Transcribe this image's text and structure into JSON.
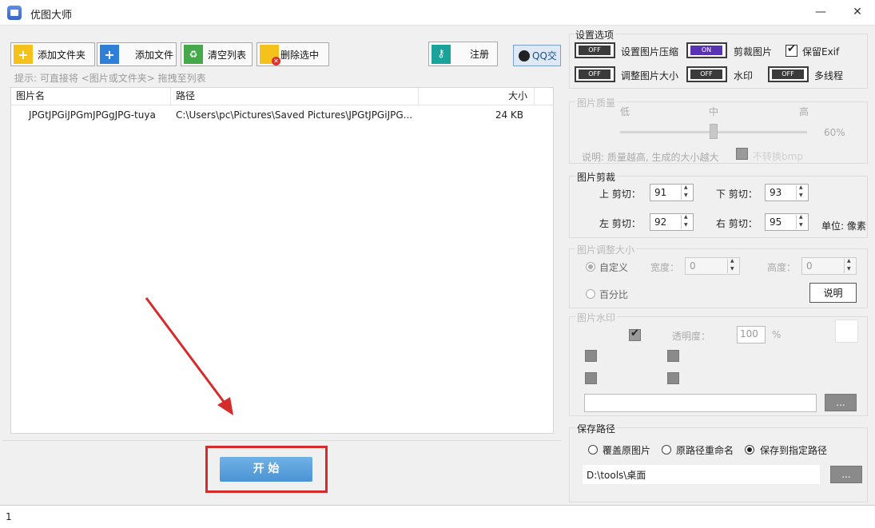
{
  "window": {
    "title": "优图大师",
    "minimize": "—",
    "close": "✕"
  },
  "toolbar": {
    "add_folder": "添加文件夹",
    "add_file": "添加文件",
    "clear_list": "清空列表",
    "delete_selected": "删除选中",
    "register": "注册",
    "qq": "QQ交"
  },
  "hint": "提示: 可直接将 <图片或文件夹> 拖拽至列表",
  "table": {
    "columns": [
      "图片名",
      "路径",
      "大小"
    ],
    "rows": [
      {
        "name": "JPGtJPGiJPGmJPGgJPG-tuya",
        "path": "C:\\Users\\pc\\Pictures\\Saved Pictures\\JPGtJPGiJPG...",
        "size": "24 KB"
      }
    ]
  },
  "start_button": "开 始",
  "settings": {
    "title": "设置选项",
    "off": "OFF",
    "on": "ON",
    "compress": "设置图片压缩",
    "crop": "剪裁图片",
    "keep_exif": "保留Exif",
    "resize": "调整图片大小",
    "watermark": "水印",
    "multithread": "多线程"
  },
  "quality": {
    "title": "图片质量",
    "low": "低",
    "mid": "中",
    "high": "高",
    "value": "60%",
    "level": 0.6,
    "note": "说明: 质量越高, 生成的大小越大",
    "bmp_option": "不转换bmp"
  },
  "crop": {
    "title": "图片剪裁",
    "top_label": "上 剪切：",
    "top": "91",
    "bottom_label": "下 剪切：",
    "bottom": "93",
    "left_label": "左 剪切：",
    "left": "92",
    "right_label": "右 剪切：",
    "right": "95",
    "unit": "单位: 像素"
  },
  "resize": {
    "title": "图片调整大小",
    "custom": "自定义",
    "width_label": "宽度：",
    "width": "0",
    "height_label": "高度：",
    "height": "0",
    "percent": "百分比",
    "explain": "说明"
  },
  "watermark": {
    "title": "图片水印",
    "opacity_label": "透明度：",
    "opacity": "100",
    "percent_sign": "%",
    "browse": "..."
  },
  "save": {
    "title": "保存路径",
    "overwrite": "覆盖原图片",
    "rename": "原路径重命名",
    "save_to": "保存到指定路径",
    "path": "D:\\tools\\桌面",
    "browse": "..."
  },
  "status": {
    "text": "1"
  },
  "colors": {
    "accent_on": "#5a33b5",
    "start_button": "#5aa2dd",
    "highlight": "#d62b2b"
  }
}
